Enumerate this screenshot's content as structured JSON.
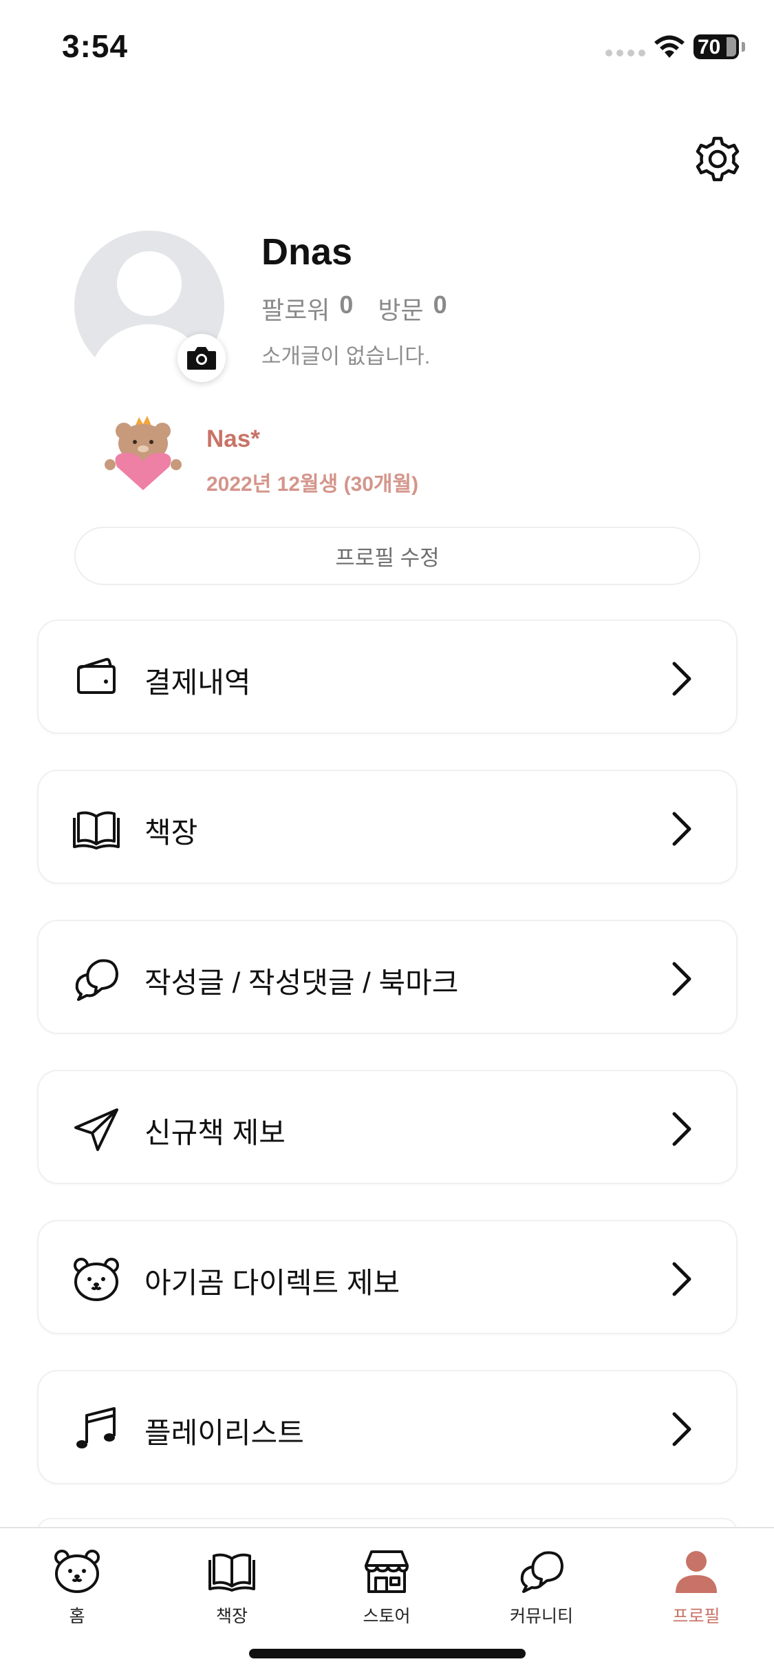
{
  "status_bar": {
    "time": "3:54",
    "battery": "70"
  },
  "header": {
    "settings_icon": "gear-icon"
  },
  "profile": {
    "name": "Dnas",
    "followers_label": "팔로워",
    "followers_count": "0",
    "visits_label": "방문",
    "visits_count": "0",
    "bio": "소개글이 없습니다.",
    "avatar_icon": "default-avatar-icon",
    "camera_icon": "camera-icon"
  },
  "child": {
    "name": "Nas*",
    "birth": "2022년 12월생 (30개월)",
    "sticker": "bear-heart-sticker"
  },
  "edit_profile_label": "프로필 수정",
  "menu": [
    {
      "label": "결제내역",
      "icon": "wallet-icon"
    },
    {
      "label": "책장",
      "icon": "book-icon"
    },
    {
      "label": "작성글 / 작성댓글 / 북마크",
      "icon": "chat-bubble-icon"
    },
    {
      "label": "신규책 제보",
      "icon": "send-icon"
    },
    {
      "label": "아기곰 다이렉트 제보",
      "icon": "bear-icon"
    },
    {
      "label": "플레이리스트",
      "icon": "music-note-icon"
    }
  ],
  "tabs": [
    {
      "label": "홈",
      "icon": "bear-icon",
      "active": false
    },
    {
      "label": "책장",
      "icon": "book-icon",
      "active": false
    },
    {
      "label": "스토어",
      "icon": "store-icon",
      "active": false
    },
    {
      "label": "커뮤니티",
      "icon": "chat-bubble-icon",
      "active": false
    },
    {
      "label": "프로필",
      "icon": "person-icon",
      "active": true
    }
  ],
  "colors": {
    "accent": "#c87367",
    "accent_light": "#d4958b",
    "text_muted": "#8a8a8a",
    "card_border": "#f0f0f0"
  }
}
